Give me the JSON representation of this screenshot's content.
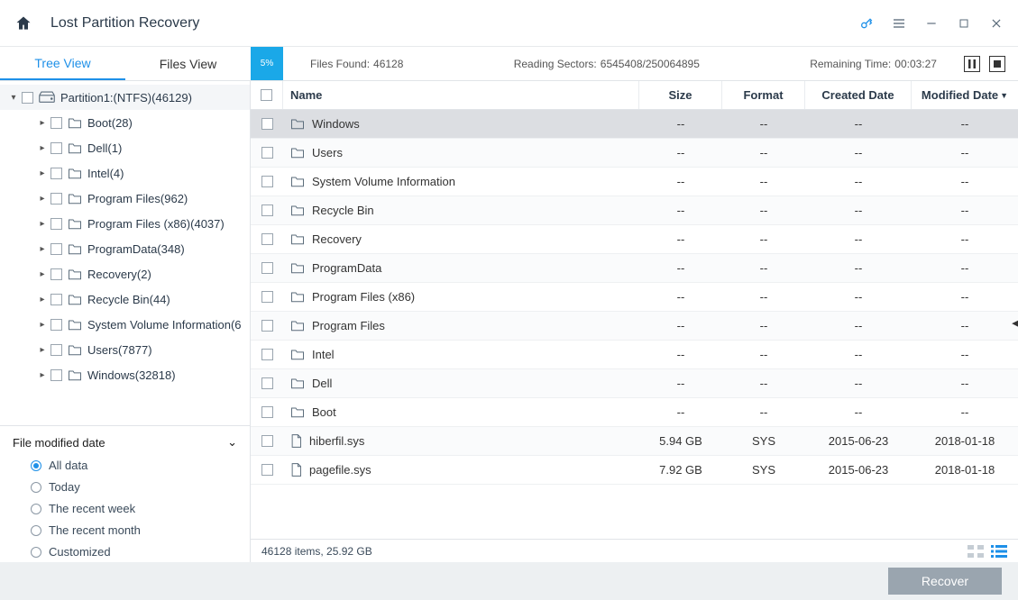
{
  "window": {
    "title": "Lost Partition Recovery"
  },
  "tabs": {
    "tree": "Tree View",
    "files": "Files View"
  },
  "progress": {
    "percent": "5%"
  },
  "status": {
    "found_label": "Files Found:",
    "found_value": "46128",
    "sectors_label": "Reading Sectors:",
    "sectors_value": "6545408/250064895",
    "remaining_label": "Remaining Time:",
    "remaining_value": "00:03:27"
  },
  "tree": {
    "root": "Partition1:(NTFS)(46129)",
    "children": [
      "Boot(28)",
      "Dell(1)",
      "Intel(4)",
      "Program Files(962)",
      "Program Files (x86)(4037)",
      "ProgramData(348)",
      "Recovery(2)",
      "Recycle Bin(44)",
      "System Volume Information(6",
      "Users(7877)",
      "Windows(32818)"
    ]
  },
  "filter": {
    "title": "File modified date",
    "options": [
      "All data",
      "Today",
      "The recent week",
      "The recent month",
      "Customized"
    ],
    "selected": 0
  },
  "table": {
    "headers": {
      "name": "Name",
      "size": "Size",
      "format": "Format",
      "created": "Created Date",
      "modified": "Modified Date"
    },
    "rows": [
      {
        "type": "folder",
        "name": "Windows",
        "size": "--",
        "format": "--",
        "created": "--",
        "modified": "--",
        "selected": true
      },
      {
        "type": "folder",
        "name": "Users",
        "size": "--",
        "format": "--",
        "created": "--",
        "modified": "--"
      },
      {
        "type": "folder",
        "name": "System Volume Information",
        "size": "--",
        "format": "--",
        "created": "--",
        "modified": "--"
      },
      {
        "type": "folder",
        "name": "Recycle Bin",
        "size": "--",
        "format": "--",
        "created": "--",
        "modified": "--"
      },
      {
        "type": "folder",
        "name": "Recovery",
        "size": "--",
        "format": "--",
        "created": "--",
        "modified": "--"
      },
      {
        "type": "folder",
        "name": "ProgramData",
        "size": "--",
        "format": "--",
        "created": "--",
        "modified": "--"
      },
      {
        "type": "folder",
        "name": "Program Files (x86)",
        "size": "--",
        "format": "--",
        "created": "--",
        "modified": "--"
      },
      {
        "type": "folder",
        "name": "Program Files",
        "size": "--",
        "format": "--",
        "created": "--",
        "modified": "--"
      },
      {
        "type": "folder",
        "name": "Intel",
        "size": "--",
        "format": "--",
        "created": "--",
        "modified": "--"
      },
      {
        "type": "folder",
        "name": "Dell",
        "size": "--",
        "format": "--",
        "created": "--",
        "modified": "--"
      },
      {
        "type": "folder",
        "name": "Boot",
        "size": "--",
        "format": "--",
        "created": "--",
        "modified": "--"
      },
      {
        "type": "file",
        "name": "hiberfil.sys",
        "size": "5.94 GB",
        "format": "SYS",
        "created": "2015-06-23",
        "modified": "2018-01-18"
      },
      {
        "type": "file",
        "name": "pagefile.sys",
        "size": "7.92 GB",
        "format": "SYS",
        "created": "2015-06-23",
        "modified": "2018-01-18"
      }
    ]
  },
  "statusbar": {
    "summary": "46128 items, 25.92 GB"
  },
  "footer": {
    "recover": "Recover"
  }
}
